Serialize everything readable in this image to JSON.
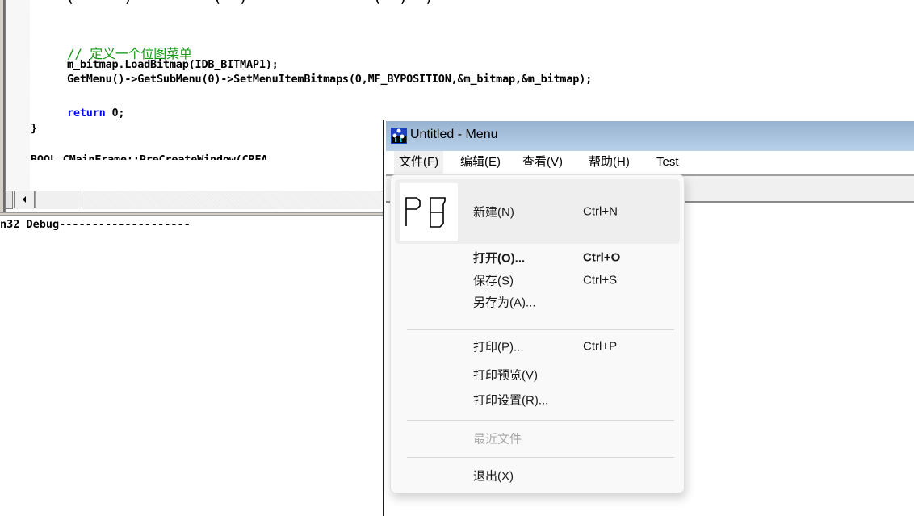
{
  "editor": {
    "lines": {
      "partial_top": "(        )             (   )                    (   )   )",
      "comment": "// 定义一个位图菜单",
      "load_bitmap": "m_bitmap.LoadBitmap(IDB_BITMAP1);",
      "set_bitmaps": "GetMenu()->GetSubMenu(0)->SetMenuItemBitmaps(0,MF_BYPOSITION,&m_bitmap,&m_bitmap);",
      "return_kw": "return",
      "return_rest": " 0;",
      "close_brace": "}",
      "clipped_next": "BOOL CMainFrame::PreCreateWindow(CREA"
    },
    "colors": {
      "keyword": "#0000ff",
      "comment": "#119911"
    }
  },
  "output": {
    "line": "n32 Debug--------------------"
  },
  "app": {
    "title": "Untitled - Menu",
    "icon": "mfc-app-icon",
    "menubar": [
      {
        "label": "文件(F)",
        "active": true
      },
      {
        "label": "编辑(E)",
        "active": false
      },
      {
        "label": "查看(V)",
        "active": false
      },
      {
        "label": "帮助(H)",
        "active": false
      },
      {
        "label": "Test",
        "active": false
      }
    ]
  },
  "file_menu": {
    "bitmap_icon": "pb-bitmap-icon",
    "items": [
      {
        "label": "新建(N)",
        "shortcut": "Ctrl+N",
        "state": "highlighted"
      },
      {
        "label": "打开(O)...",
        "shortcut": "Ctrl+O",
        "state": "bold"
      },
      {
        "label": "保存(S)",
        "shortcut": "Ctrl+S",
        "state": "normal"
      },
      {
        "label": "另存为(A)...",
        "shortcut": "",
        "state": "normal"
      },
      {
        "label": "打印(P)...",
        "shortcut": "Ctrl+P",
        "state": "normal"
      },
      {
        "label": "打印预览(V)",
        "shortcut": "",
        "state": "normal"
      },
      {
        "label": "打印设置(R)...",
        "shortcut": "",
        "state": "normal"
      },
      {
        "label": "最近文件",
        "shortcut": "",
        "state": "disabled"
      },
      {
        "label": "退出(X)",
        "shortcut": "",
        "state": "normal"
      }
    ]
  }
}
